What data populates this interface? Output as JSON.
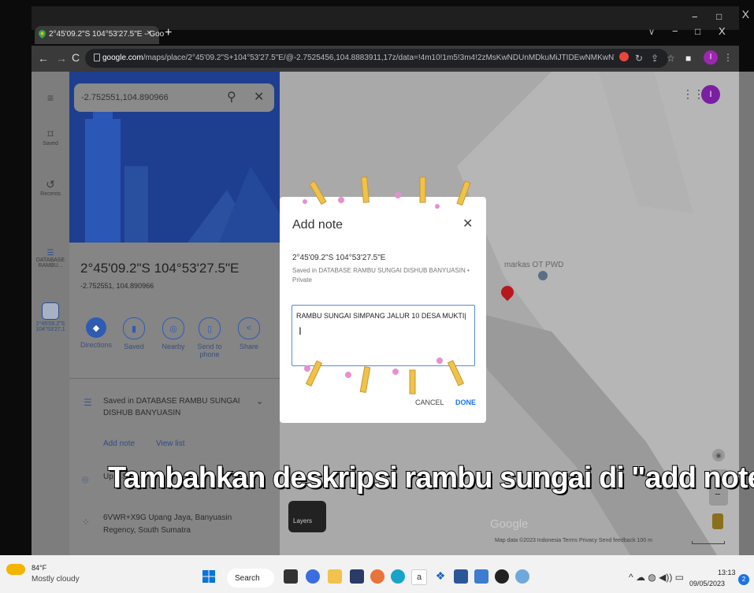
{
  "browser": {
    "tab_title": "2°45'09.2\"S 104°53'27.5\"E - Goo",
    "tab_close": "×",
    "new_tab": "+",
    "url_host": "google.com",
    "url_path": "/maps/place/2°45'09.2\"S+104°53'27.5\"E/@-2.7525456,104.8883911,17z/data=!4m10!1m5!3m4!2zMsKwNDUnMDkuMiJTIDEwNMKwNTMnMjcuNS...",
    "win_min": "−",
    "win_max": "□",
    "win_close": "X",
    "tab_dropdown": "∨",
    "outer_close": "X"
  },
  "maps": {
    "search_value": "-2.752551,104.890966",
    "rail": [
      {
        "label": "Saved"
      },
      {
        "label": "Recents"
      },
      {
        "label": "DATABASE RAMBU..."
      },
      {
        "label": "2°45'09.2\"S 104°53'27.1"
      }
    ],
    "place": {
      "title": "2°45'09.2\"S 104°53'27.5\"E",
      "coords": "-2.752551, 104.890966"
    },
    "actions": [
      {
        "label": "Directions"
      },
      {
        "label": "Saved"
      },
      {
        "label": "Nearby"
      },
      {
        "label": "Send to phone"
      },
      {
        "label": "Share"
      }
    ],
    "saved_in": "Saved in DATABASE RAMBU SUNGAI DISHUB BANYUASIN",
    "add_note": "Add note",
    "view_list": "View list",
    "address_short": "Up... So...",
    "plus_code": "6VWR+X9G Upang Jaya, Banyuasin Regency, South Sumatra",
    "marker_label": "markas OT PWD",
    "layers": "Layers",
    "google_logo": "Google",
    "footer": "Map data ©2023   Indonesia   Terms   Privacy   Send feedback   100 m",
    "avatar_letter": "I"
  },
  "dialog": {
    "title": "Add note",
    "coords": "2°45'09.2\"S 104°53'27.5\"E",
    "saved_in": "Saved in DATABASE RAMBU SUNGAI DISHUB BANYUASIN • Private",
    "note_value": "RAMBU SUNGAI SIMPANG JALUR 10 DESA MUKTI|",
    "cancel": "CANCEL",
    "done": "DONE"
  },
  "subtitle": "Tambahkan deskripsi rambu sungai di \"add note\"",
  "taskbar": {
    "weather_temp": "84°F",
    "weather_desc": "Mostly cloudy",
    "search": "Search",
    "time": "13:13",
    "date": "09/05/2023",
    "notifications": "2"
  }
}
